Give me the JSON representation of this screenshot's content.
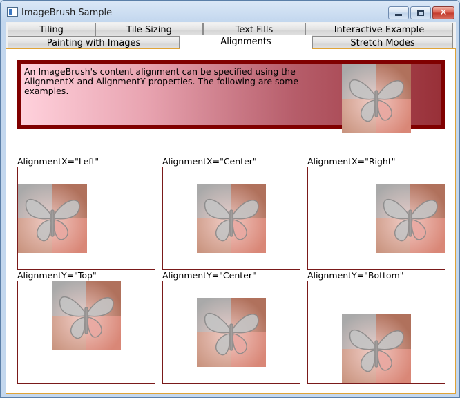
{
  "window": {
    "title": "ImageBrush Sample"
  },
  "tabs": {
    "row1": [
      "Tiling",
      "Tile Sizing",
      "Text Fills",
      "Interactive Example"
    ],
    "row2": [
      "Painting with Images",
      "Alignments",
      "Stretch Modes"
    ],
    "active": "Alignments"
  },
  "banner": {
    "text": "An ImageBrush's content alignment can be specified using the AlignmentX and AlignmentY properties. The following are some examples."
  },
  "examples": [
    {
      "label": "AlignmentX=\"Left\""
    },
    {
      "label": "AlignmentX=\"Center\""
    },
    {
      "label": "AlignmentX=\"Right\""
    },
    {
      "label": "AlignmentY=\"Top\""
    },
    {
      "label": "AlignmentY=\"Center\""
    },
    {
      "label": "AlignmentY=\"Bottom\""
    }
  ],
  "colors": {
    "banner_border": "#800000",
    "frame_border": "#7a1a1a",
    "content_border": "#e0a336"
  },
  "icons": {
    "app": "window-app-icon",
    "minimize": "minimize-icon",
    "maximize": "maximize-icon",
    "close": "close-icon"
  }
}
